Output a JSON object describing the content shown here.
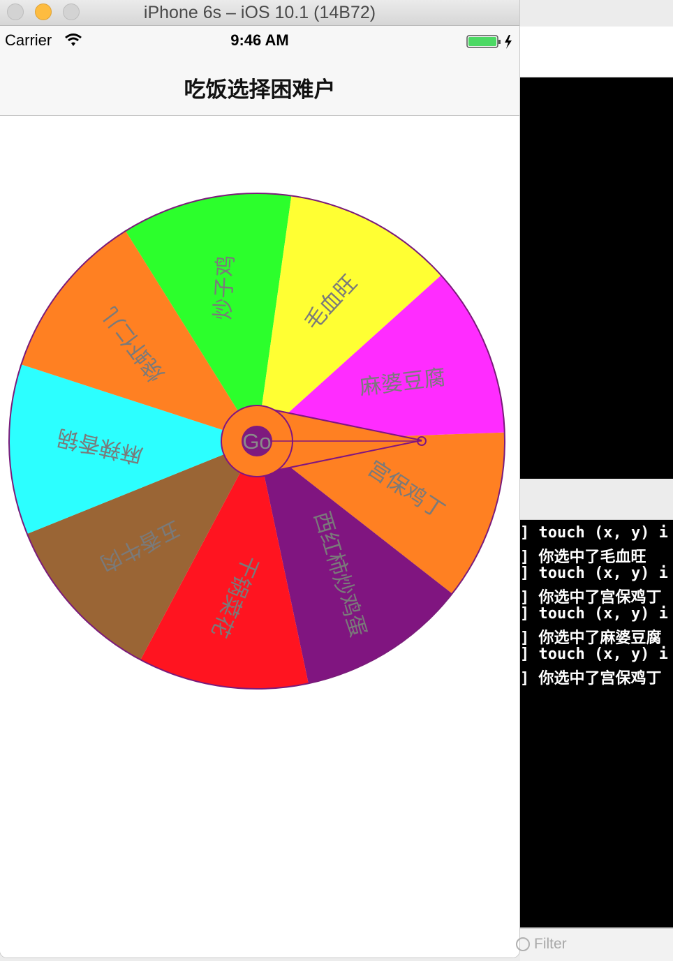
{
  "window": {
    "title": "iPhone 6s – iOS 10.1 (14B72)"
  },
  "status_bar": {
    "carrier": "Carrier",
    "time": "9:46 AM"
  },
  "nav": {
    "title": "吃饭选择困难户"
  },
  "wheel": {
    "go_label": "Go",
    "border_color": "#7a1a7a",
    "segments": [
      {
        "label": "宫保鸡丁",
        "color": "#ff8022"
      },
      {
        "label": "西红柿炒鸡蛋",
        "color": "#801580"
      },
      {
        "label": "干锅菜花",
        "color": "#ff1420"
      },
      {
        "label": "五香牛肉",
        "color": "#9a6535"
      },
      {
        "label": "麻辣香锅",
        "color": "#2cffff"
      },
      {
        "label": "烧虾仁儿",
        "color": "#ff8022"
      },
      {
        "label": "炒子鸡",
        "color": "#2cff2c"
      },
      {
        "label": "毛血旺",
        "color": "#ffff33"
      },
      {
        "label": "麻婆豆腐",
        "color": "#ff2cff"
      }
    ]
  },
  "console": {
    "lines": [
      "] touch (x, y) i",
      "] 你选中了毛血旺",
      "] touch (x, y) i",
      "] 你选中了宫保鸡丁",
      "] touch (x, y) i",
      "] 你选中了麻婆豆腐",
      "] touch (x, y) i",
      "] 你选中了宫保鸡丁"
    ],
    "filter_placeholder": "Filter"
  }
}
